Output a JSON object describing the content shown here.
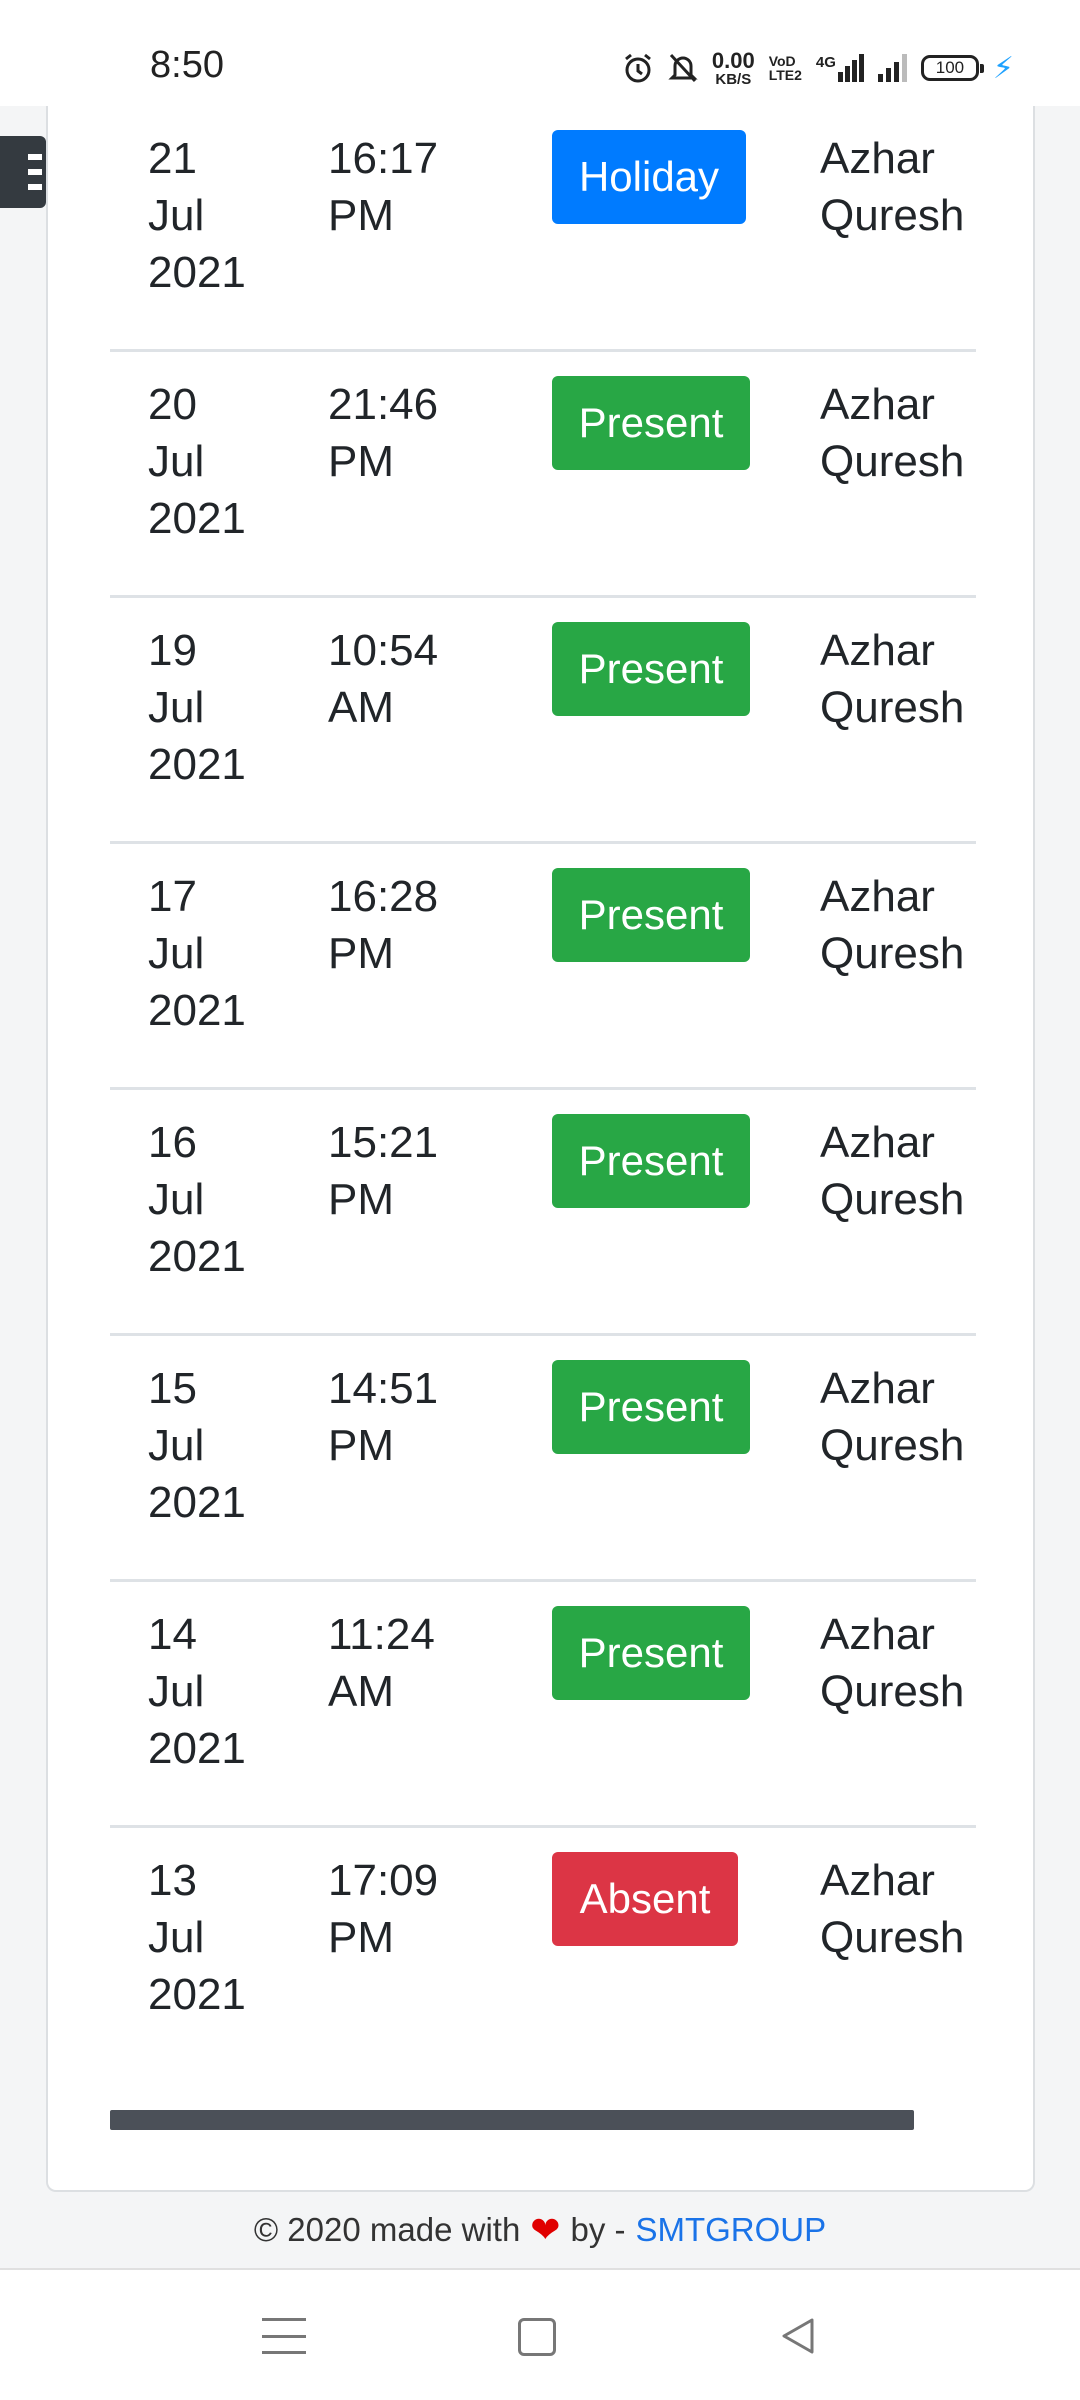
{
  "status_bar": {
    "time": "8:50",
    "net_speed_value": "0.00",
    "net_speed_unit": "KB/S",
    "volte_top": "VoD",
    "volte_bottom": "LTE2",
    "network": "4G",
    "battery": "100"
  },
  "attendance": {
    "rows": [
      {
        "day": "21",
        "month": "Jul",
        "year": "2021",
        "time": "16:17",
        "period": "PM",
        "status": "Holiday",
        "type": "holiday",
        "name_first": "Azhar",
        "name_last": "Quresh"
      },
      {
        "day": "20",
        "month": "Jul",
        "year": "2021",
        "time": "21:46",
        "period": "PM",
        "status": "Present",
        "type": "present",
        "name_first": "Azhar",
        "name_last": "Quresh"
      },
      {
        "day": "19",
        "month": "Jul",
        "year": "2021",
        "time": "10:54",
        "period": "AM",
        "status": "Present",
        "type": "present",
        "name_first": "Azhar",
        "name_last": "Quresh"
      },
      {
        "day": "17",
        "month": "Jul",
        "year": "2021",
        "time": "16:28",
        "period": "PM",
        "status": "Present",
        "type": "present",
        "name_first": "Azhar",
        "name_last": "Quresh"
      },
      {
        "day": "16",
        "month": "Jul",
        "year": "2021",
        "time": "15:21",
        "period": "PM",
        "status": "Present",
        "type": "present",
        "name_first": "Azhar",
        "name_last": "Quresh"
      },
      {
        "day": "15",
        "month": "Jul",
        "year": "2021",
        "time": "14:51",
        "period": "PM",
        "status": "Present",
        "type": "present",
        "name_first": "Azhar",
        "name_last": "Quresh"
      },
      {
        "day": "14",
        "month": "Jul",
        "year": "2021",
        "time": "11:24",
        "period": "AM",
        "status": "Present",
        "type": "present",
        "name_first": "Azhar",
        "name_last": "Quresh"
      },
      {
        "day": "13",
        "month": "Jul",
        "year": "2021",
        "time": "17:09",
        "period": "PM",
        "status": "Absent",
        "type": "absent",
        "name_first": "Azhar",
        "name_last": "Quresh"
      }
    ]
  },
  "footer": {
    "text_before": "© 2020 made with",
    "text_after": "by -",
    "link_text": "SMTGROUP"
  },
  "colors": {
    "holiday": "#007bff",
    "present": "#28a745",
    "absent": "#dc3545",
    "link": "#1a73e8"
  }
}
